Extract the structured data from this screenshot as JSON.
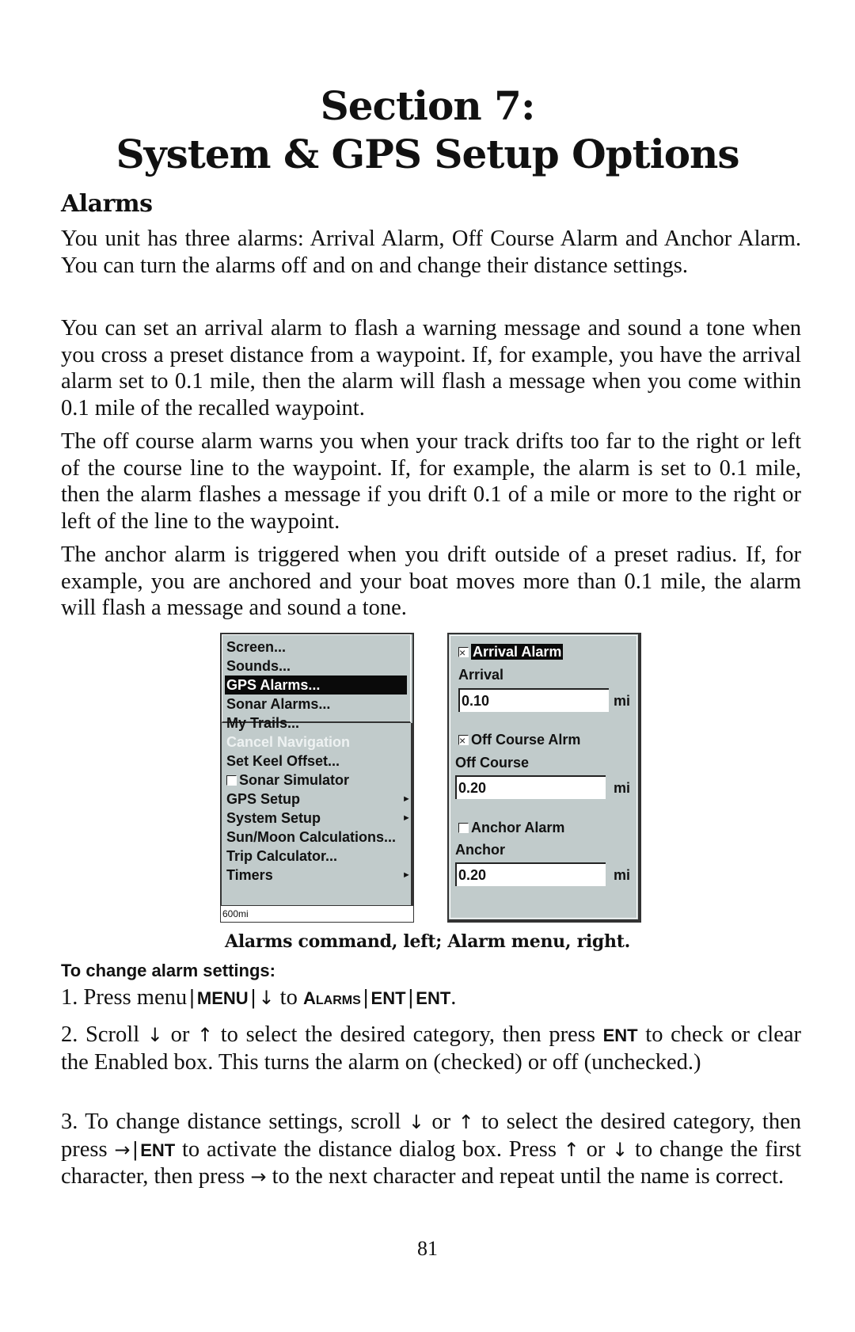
{
  "header": {
    "title_line1": "Section 7:",
    "title_line2": "System & GPS Setup Options"
  },
  "section": {
    "heading": "Alarms",
    "paragraphs": [
      "You unit has three alarms: Arrival Alarm, Off Course Alarm and Anchor Alarm. You can turn the alarms off and on and change their distance settings.",
      "You can set an arrival alarm to flash a warning message and sound a tone when you cross a preset distance from a waypoint. If, for example, you have the arrival alarm set to 0.1 mile, then the alarm will flash a message when you come within 0.1 mile of the recalled waypoint.",
      "The off course alarm warns you when your track drifts too far to the right or left of the course line to the waypoint. If, for example, the alarm is set to 0.1 mile, then the alarm flashes a message if you drift 0.1 of a mile or more to the right or left of the line to the waypoint.",
      "The anchor alarm is triggered when you drift outside of a preset radius. If, for example, you are anchored and your boat moves more than 0.1 mile, the alarm will flash a message and sound a tone."
    ]
  },
  "menu_screen": {
    "items": [
      {
        "label": "Screen..."
      },
      {
        "label": "Sounds..."
      },
      {
        "label": "GPS Alarms...",
        "selected": true
      },
      {
        "label": "Sonar Alarms..."
      },
      {
        "label": "My Trails..."
      },
      {
        "label": "Cancel Navigation",
        "disabled": true
      },
      {
        "label": "Set Keel Offset..."
      },
      {
        "label": "Sonar Simulator",
        "checkbox": false
      },
      {
        "label": "GPS Setup",
        "submenu": true
      },
      {
        "label": "System Setup",
        "submenu": true
      },
      {
        "label": "Sun/Moon Calculations..."
      },
      {
        "label": "Trip Calculator..."
      },
      {
        "label": "Timers",
        "submenu": true
      }
    ],
    "status_bar": "600mi",
    "submenu_glyph": "►"
  },
  "alarm_screen": {
    "alarms": [
      {
        "toggle_label": "Arrival Alarm",
        "checked": true,
        "highlighted": true,
        "field_label": "Arrival",
        "value": "0.10",
        "unit": "mi"
      },
      {
        "toggle_label": "Off Course Alrm",
        "checked": true,
        "highlighted": false,
        "field_label": "Off Course",
        "value": "0.20",
        "unit": "mi"
      },
      {
        "toggle_label": "Anchor Alarm",
        "checked": false,
        "highlighted": false,
        "field_label": "Anchor",
        "value": "0.20",
        "unit": "mi"
      }
    ]
  },
  "figure": {
    "caption": "Alarms command, left; Alarm menu, right."
  },
  "procedure": {
    "heading": "To change alarm settings:",
    "step1": {
      "prefix": "1. Press menu",
      "key_menu": "MENU",
      "down_arrow": "↓",
      "to": " to ",
      "target_cap": "A",
      "target_rest": "LARMS",
      "key_ent1": "ENT",
      "key_ent2": "ENT",
      "end": "."
    },
    "step2": {
      "t1": "2. Scroll ",
      "down": "↓",
      "t2": " or ",
      "up": "↑",
      "t3": " to select the desired category, then press ",
      "key": "ENT",
      "t4": " to check or clear the Enabled box. This turns the alarm on (checked) or off (unchecked.)"
    },
    "step3": {
      "t1": "3. To change distance settings, scroll ",
      "down": "↓",
      "t2": " or ",
      "up": "↑",
      "t3": " to select the desired category, then press ",
      "right": "→",
      "key": "ENT",
      "t4": " to activate the distance dialog box. Press ",
      "up2": "↑",
      "t5": " or ",
      "down2": "↓",
      "t6": " to change the first character, then press ",
      "right2": "→",
      "t7": " to the next character and repeat until the name is correct."
    }
  },
  "footer": {
    "page_number": "81"
  }
}
